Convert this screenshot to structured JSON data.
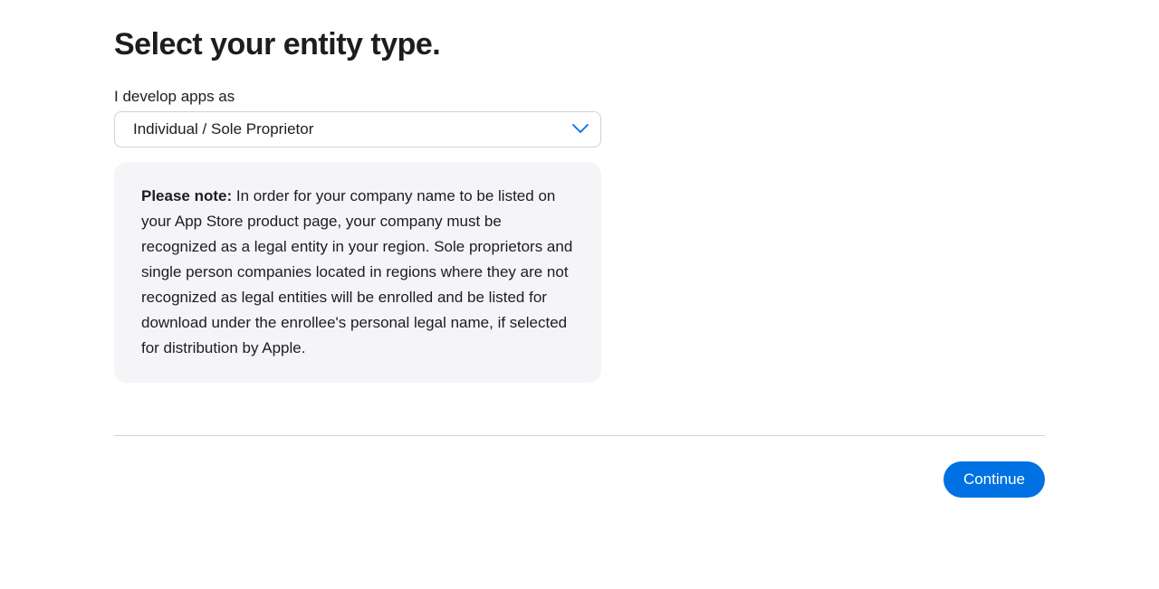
{
  "heading": "Select your entity type.",
  "form": {
    "entity_label": "I develop apps as",
    "entity_selected": "Individual / Sole Proprietor"
  },
  "note": {
    "prefix": "Please note:",
    "body": " In order for your company name to be listed on your App Store product page, your company must be recognized as a legal entity in your region. Sole proprietors and single person companies located in regions where they are not recognized as legal entities will be enrolled and be listed for download under the enrollee's personal legal name, if selected for distribution by Apple."
  },
  "actions": {
    "continue_label": "Continue"
  },
  "colors": {
    "accent": "#0071e3",
    "chevron": "#0071e3",
    "card_bg": "#f5f5f7",
    "border": "#d2d2d7"
  }
}
